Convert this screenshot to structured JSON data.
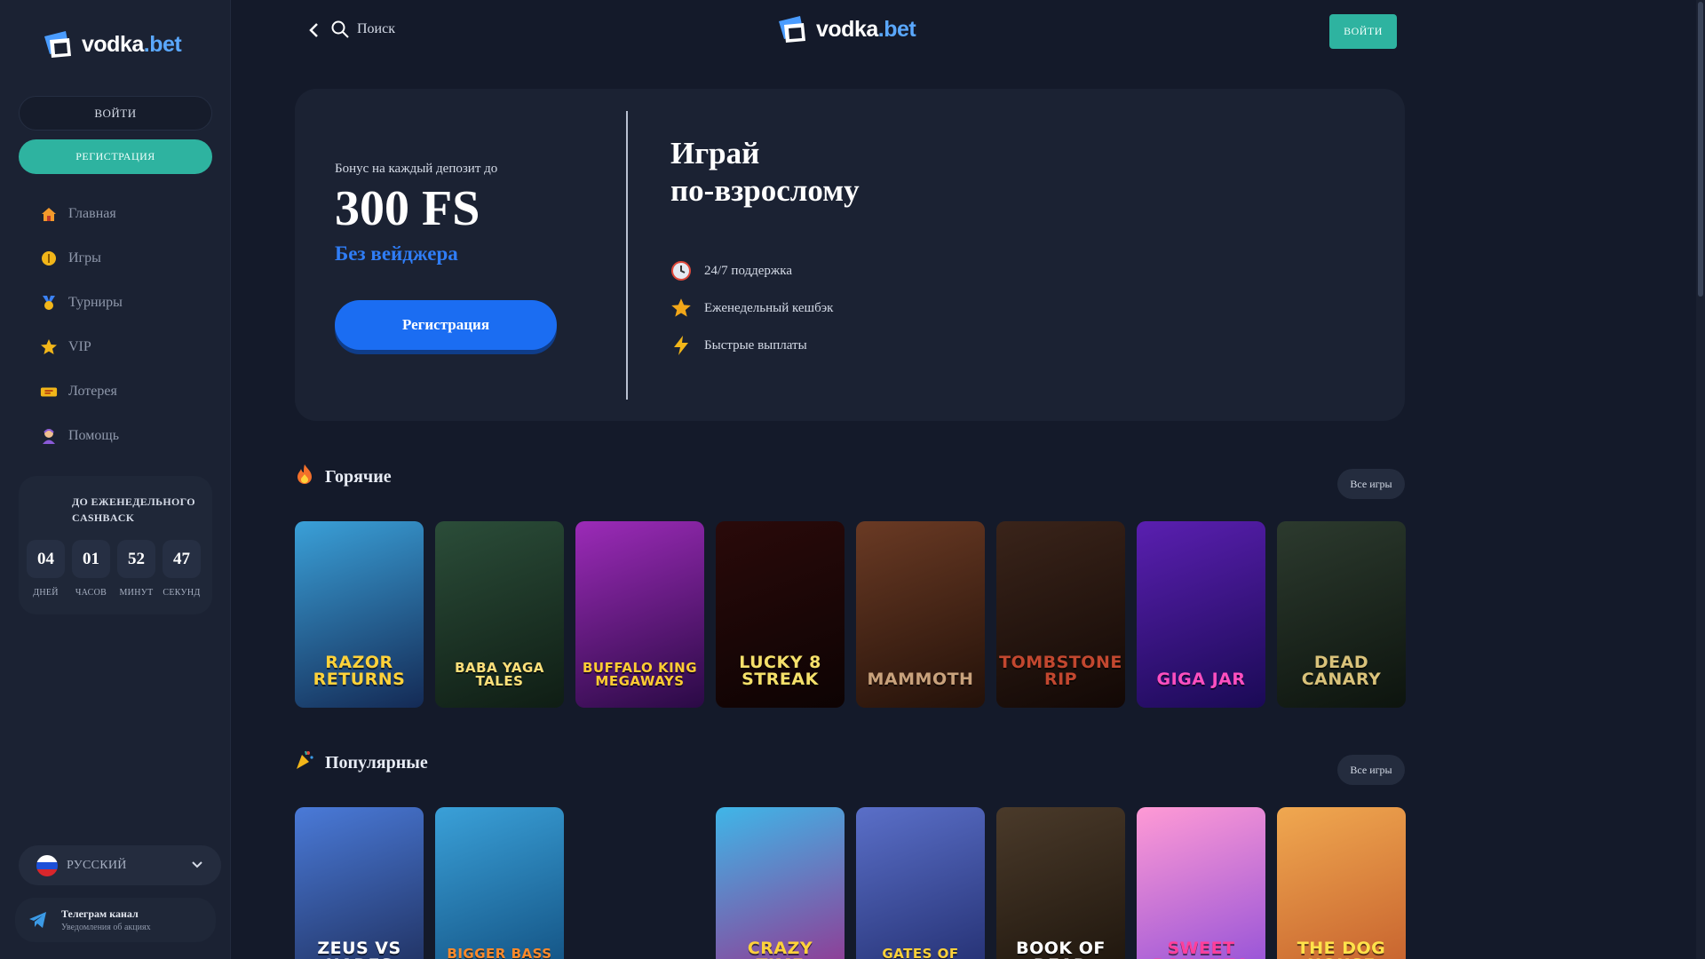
{
  "brand": {
    "name_main": "vodka",
    "name_accent": ".bet"
  },
  "sidebar": {
    "login_label": "ВОЙТИ",
    "register_label": "РЕГИСТРАЦИЯ",
    "nav": [
      {
        "label": "Главная",
        "icon": "home-icon"
      },
      {
        "label": "Игры",
        "icon": "coin-icon"
      },
      {
        "label": "Турниры",
        "icon": "medal-icon"
      },
      {
        "label": "VIP",
        "icon": "star-icon"
      },
      {
        "label": "Лотерея",
        "icon": "ticket-icon"
      },
      {
        "label": "Помощь",
        "icon": "support-agent-icon"
      }
    ],
    "cashback": {
      "title": "ДО ЕЖЕНЕДЕЛЬНОГО CASHBACK",
      "days": "04",
      "days_label": "ДНЕЙ",
      "hours": "01",
      "hours_label": "ЧАСОВ",
      "minutes": "52",
      "minutes_label": "МИНУТ",
      "seconds": "47",
      "seconds_label": "СЕКУНД"
    },
    "language": "РУССКИЙ",
    "telegram": {
      "title": "Телеграм канал",
      "subtitle": "Уведомления об акциях"
    }
  },
  "header": {
    "search_label": "Поиск",
    "login_label": "ВОЙТИ"
  },
  "promo": {
    "subtitle": "Бонус на каждый депозит до",
    "amount": "300 FS",
    "wager": "Без вейджера",
    "button_label": "Регистрация",
    "heading_line1": "Играй",
    "heading_line2": "по-взрослому",
    "perks": [
      {
        "label": "24/7 поддержка",
        "icon": "clock-icon"
      },
      {
        "label": "Еженедельный кешбэк",
        "icon": "star-icon"
      },
      {
        "label": "Быстрые выплаты",
        "icon": "lightning-icon"
      }
    ]
  },
  "sections": {
    "hot": {
      "title": "Горячие",
      "all_label": "Все игры",
      "games": [
        {
          "title": "Razor Returns",
          "bg1": "#3aa0d8",
          "bg2": "#142a55",
          "fg": "#ffd23a"
        },
        {
          "title": "Baba Yaga Tales",
          "bg1": "#2b4d39",
          "bg2": "#0f1d14",
          "fg": "#ffe07a"
        },
        {
          "title": "Buffalo King Megaways",
          "bg1": "#9c2bb8",
          "bg2": "#2a0a45",
          "fg": "#ffcc33"
        },
        {
          "title": "Lucky 8 Streak",
          "bg1": "#2a0a0a",
          "bg2": "#0d0303",
          "fg": "#f5e06a"
        },
        {
          "title": "Mammoth",
          "bg1": "#6a3a24",
          "bg2": "#231109",
          "fg": "#c9a27c"
        },
        {
          "title": "Tombstone RIP",
          "bg1": "#3a241a",
          "bg2": "#120805",
          "fg": "#c2472f"
        },
        {
          "title": "Giga Jar",
          "bg1": "#5a1fb0",
          "bg2": "#1a0a55",
          "fg": "#ff4fbf"
        },
        {
          "title": "Dead Canary",
          "bg1": "#2c3a2e",
          "bg2": "#0d140e",
          "fg": "#d9c27a"
        }
      ]
    },
    "popular": {
      "title": "Популярные",
      "all_label": "Все игры",
      "games": [
        {
          "title": "Zeus vs Hades",
          "bg1": "#4a7ad8",
          "bg2": "#1c2a55",
          "fg": "#ffffff"
        },
        {
          "title": "Bigger Bass Bonanza",
          "bg1": "#3aa0d8",
          "bg2": "#0f4a7a",
          "fg": "#ff8a2a"
        },
        {
          "title": "",
          "bg1": "#141a2a",
          "bg2": "#141a2a",
          "fg": "#141a2a"
        },
        {
          "title": "Crazy Time",
          "bg1": "#3fb6e8",
          "bg2": "#9b2c8a",
          "fg": "#ffd23a"
        },
        {
          "title": "Gates of Olympus",
          "bg1": "#5a6fc8",
          "bg2": "#1f2a6a",
          "fg": "#ffd23a"
        },
        {
          "title": "Book of Dead",
          "bg1": "#4a3a2a",
          "bg2": "#1a120a",
          "fg": "#ffffff"
        },
        {
          "title": "Sweet Bonanza",
          "bg1": "#ff9ad5",
          "bg2": "#8a4bd8",
          "fg": "#ff3f9a"
        },
        {
          "title": "The Dog House",
          "bg1": "#f0a850",
          "bg2": "#c25a2a",
          "fg": "#ffe24a"
        }
      ]
    }
  },
  "colors": {
    "accent_teal": "#2eb3a0",
    "accent_blue": "#1b6df2",
    "background": "#141a2a",
    "panel": "#1b2233"
  }
}
